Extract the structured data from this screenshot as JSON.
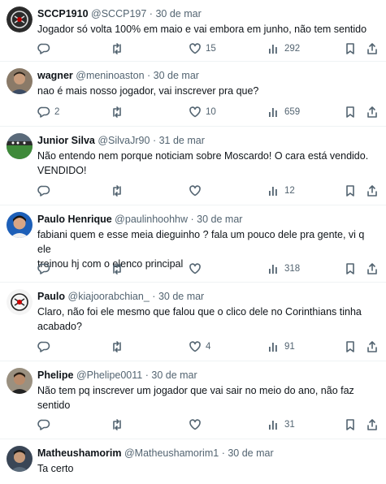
{
  "replies": [
    {
      "name": "SCCP1910",
      "handle": "@SCCP197",
      "date": "30 de mar",
      "text": "Jogador só volta 100% em maio e vai embora em junho, não tem sentido",
      "replies": "",
      "reposts": "",
      "likes": "15",
      "views": "292",
      "avatar": "corinthians-logo-dark"
    },
    {
      "name": "wagner",
      "handle": "@meninoaston",
      "date": "30 de mar",
      "text": "nao é mais nosso jogador, vai inscrever pra que?",
      "replies": "2",
      "reposts": "",
      "likes": "10",
      "views": "659",
      "avatar": "photo-man"
    },
    {
      "name": "Junior Silva",
      "handle": "@SilvaJr90",
      "date": "31 de mar",
      "text": "Não entendo nem porque noticiam sobre Moscardo! O cara está vendido.\nVENDIDO!",
      "replies": "",
      "reposts": "",
      "likes": "",
      "views": "12",
      "avatar": "photo-stadium"
    },
    {
      "name": "Paulo Henrique",
      "handle": "@paulinhoohhw",
      "date": "30 de mar",
      "text": "fabiani quem e esse meia dieguinho ? fala um pouco dele pra gente, vi q ele\ntreinou hj com o elenco principal",
      "replies": "",
      "reposts": "",
      "likes": "",
      "views": "318",
      "avatar": "photo-person"
    },
    {
      "name": "Paulo",
      "handle": "@kiajoorabchian_",
      "date": "30 de mar",
      "text": "Claro, não foi ele mesmo que falou que o clico dele no Corinthians tinha\nacabado?",
      "replies": "",
      "reposts": "",
      "likes": "4",
      "views": "91",
      "avatar": "corinthians-logo-light"
    },
    {
      "name": "Phelipe",
      "handle": "@Phelipe0011",
      "date": "30 de mar",
      "text": "Não tem pq inscrever um jogador que vai sair no meio do ano, não faz\nsentido",
      "replies": "",
      "reposts": "",
      "likes": "",
      "views": "31",
      "avatar": "photo-man-2"
    },
    {
      "name": "Matheushamorim",
      "handle": "@Matheushamorim1",
      "date": "30 de mar",
      "text": "Ta certo",
      "replies": "",
      "reposts": "",
      "likes": "",
      "views": "",
      "avatar": "photo-man-3"
    }
  ],
  "colors": {
    "text": "#0f1419",
    "secondary": "#536471",
    "divider": "#eff3f4"
  }
}
